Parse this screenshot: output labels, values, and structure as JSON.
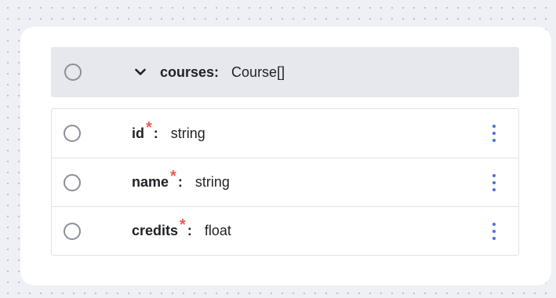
{
  "group": {
    "name": "courses",
    "colon": ":",
    "type": "Course[]"
  },
  "fields": [
    {
      "name": "id",
      "required_mark": "*",
      "colon": ":",
      "type": "string"
    },
    {
      "name": "name",
      "required_mark": "*",
      "colon": ":",
      "type": "string"
    },
    {
      "name": "credits",
      "required_mark": "*",
      "colon": ":",
      "type": "float"
    }
  ],
  "icons": {
    "radio": "radio-circle-icon",
    "expand": "chevron-down-icon",
    "menu": "kebab-menu-icon"
  },
  "colors": {
    "required": "#ee5a52",
    "menu_dots": "#4a6fd8",
    "header_bg": "#e6e8ee",
    "canvas_bg": "#eef0f5"
  }
}
